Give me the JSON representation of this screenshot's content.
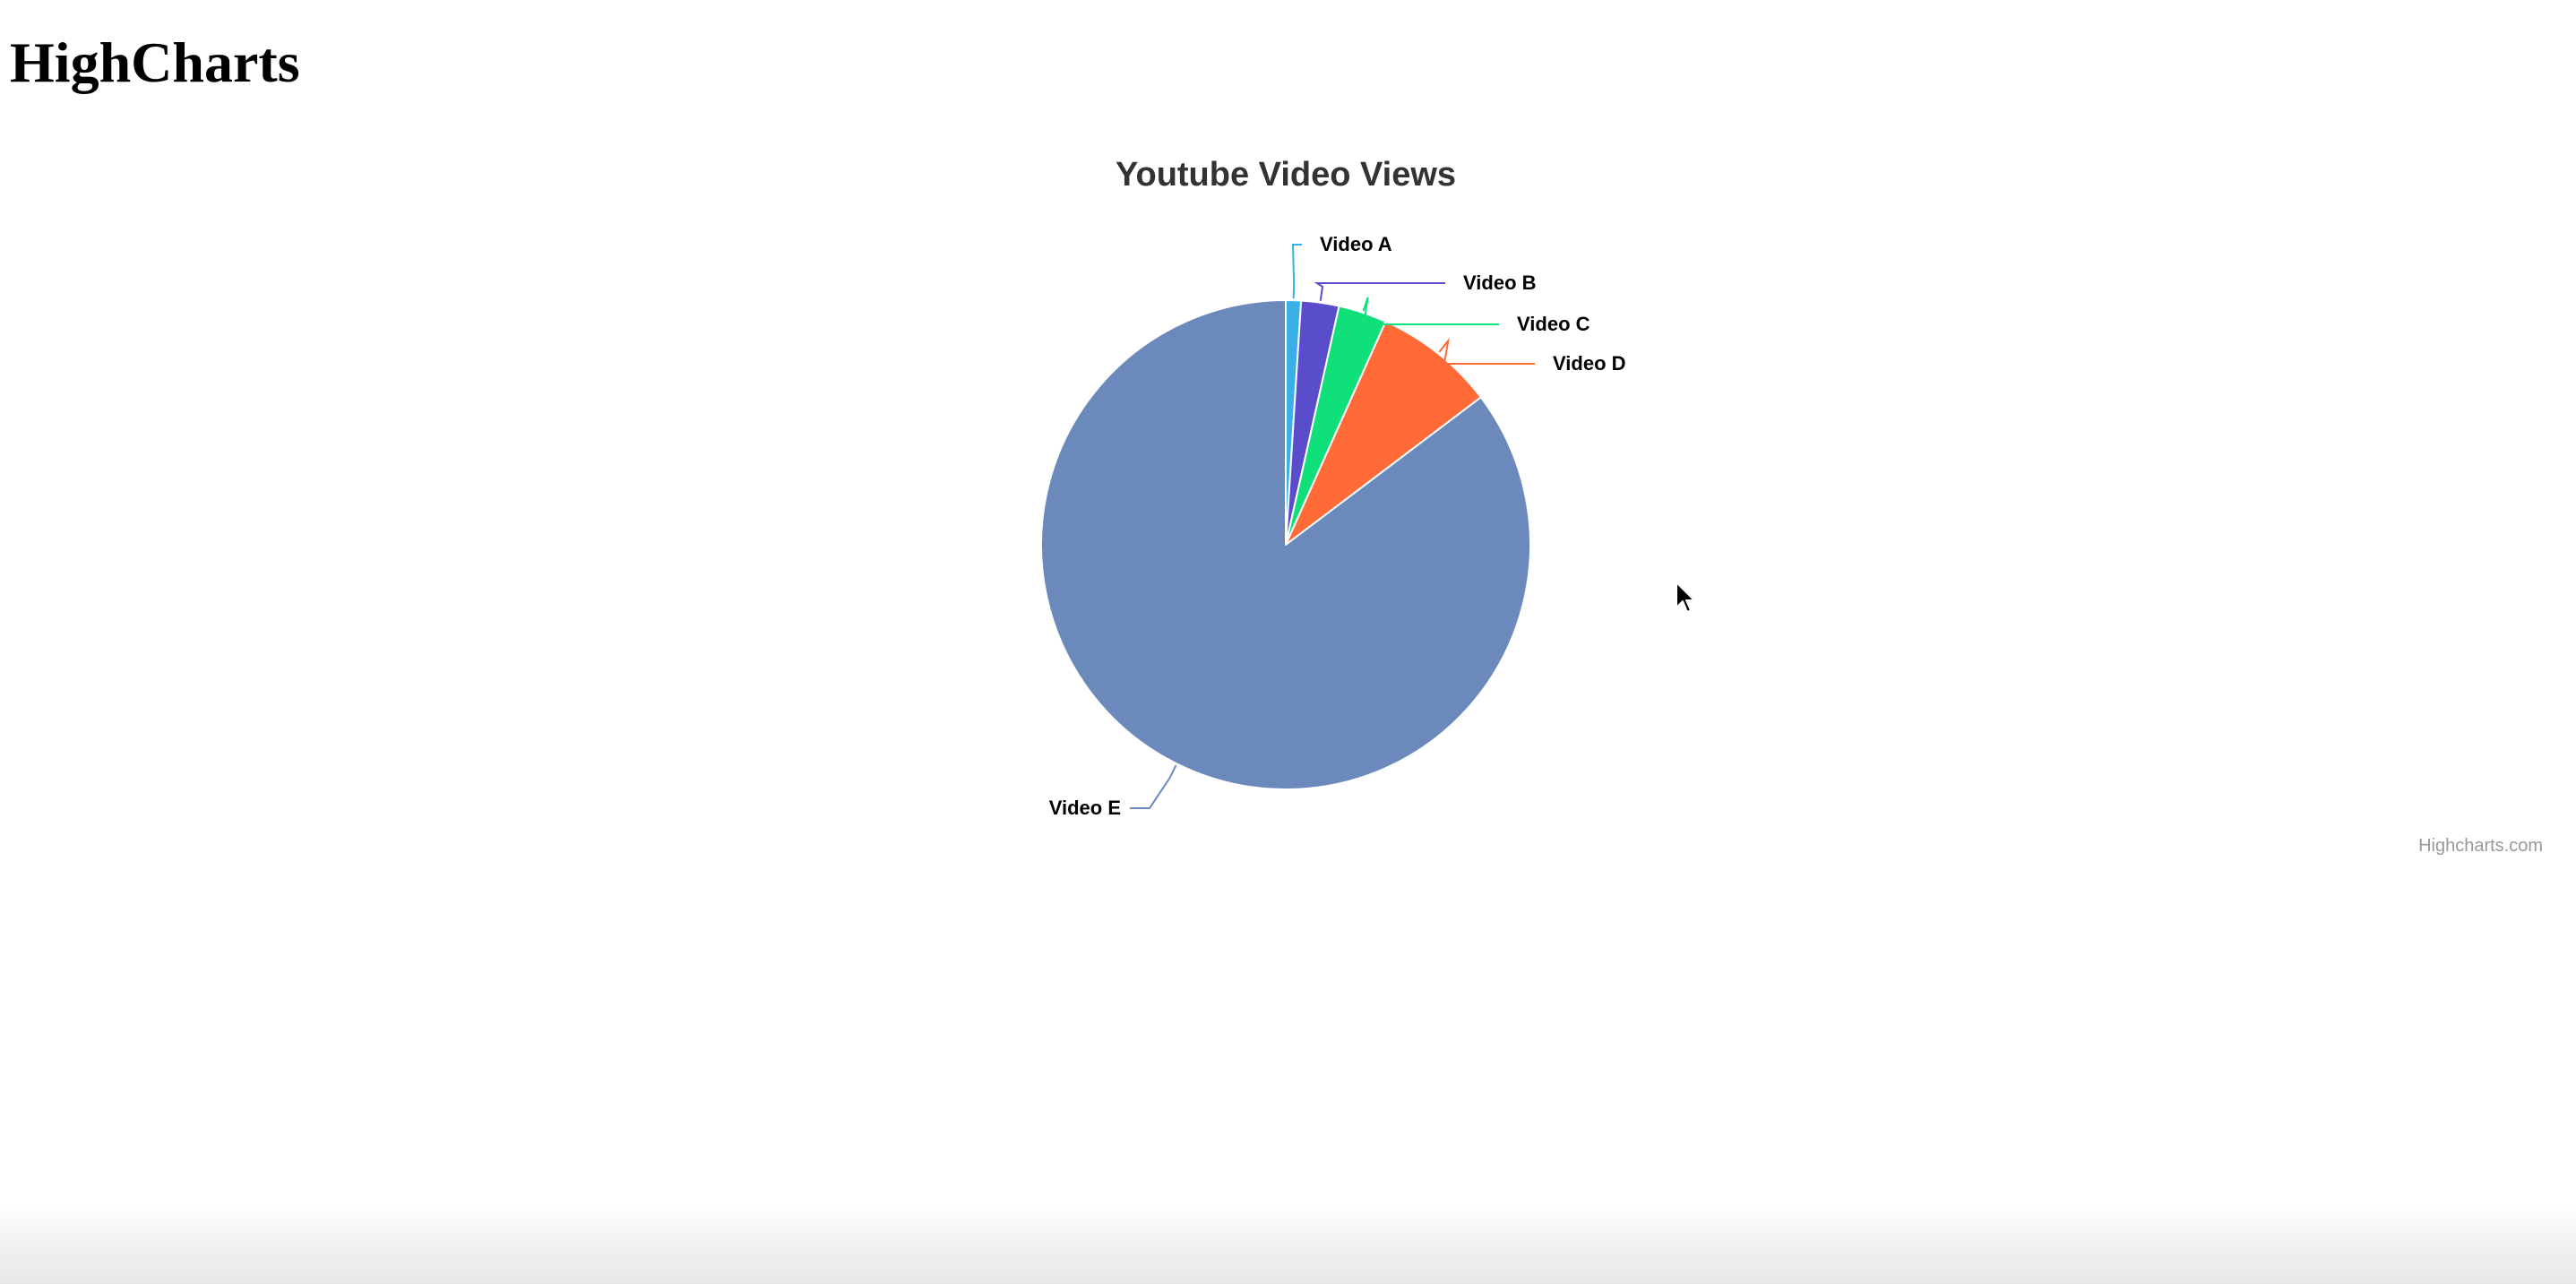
{
  "page": {
    "heading": "HighCharts"
  },
  "chart_data": {
    "type": "pie",
    "title": "Youtube Video Views",
    "credits": "Highcharts.com",
    "categories": [
      "Video A",
      "Video B",
      "Video C",
      "Video D",
      "Video E"
    ],
    "values": [
      1.0,
      2.5,
      3.2,
      8.0,
      85.3
    ],
    "unit": "%",
    "colors": [
      "#39b1e6",
      "#5a4dcc",
      "#10e07a",
      "#ff6a37",
      "#6b8abb"
    ],
    "start_angle_deg": 0,
    "legend": "none"
  }
}
